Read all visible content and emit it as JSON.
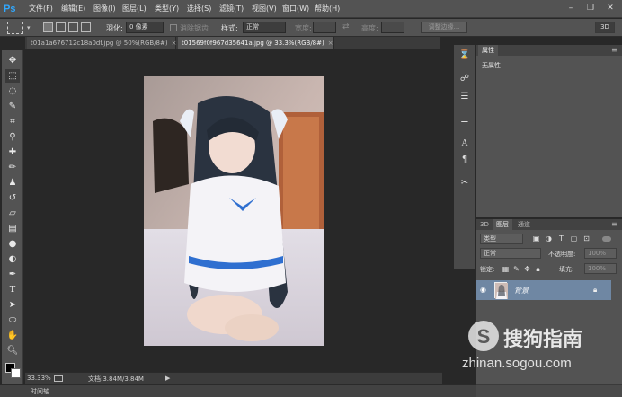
{
  "app": {
    "logo": "Ps"
  },
  "menu": [
    "文件(F)",
    "编辑(E)",
    "图像(I)",
    "图层(L)",
    "类型(Y)",
    "选择(S)",
    "滤镜(T)",
    "视图(V)",
    "窗口(W)",
    "帮助(H)"
  ],
  "options": {
    "feather_label": "羽化:",
    "feather_value": "0 像素",
    "antialias_label": "消除锯齿",
    "style_label": "样式:",
    "style_value": "正常",
    "width_label": "宽度:",
    "height_label": "高度:",
    "refine_edge": "调整边缘...",
    "workspace": "3D"
  },
  "tabs": [
    {
      "label": "t01a1a676712c18a0df.jpg @ 50%(RGB/8#)",
      "close": "×"
    },
    {
      "label": "t01569f0f967d35641a.jpg @ 33.3%(RGB/8#)",
      "close": "×"
    }
  ],
  "status": {
    "zoom": "33.33%",
    "doc": "文档:3.84M/3.84M"
  },
  "timeline": {
    "label": "时间轴"
  },
  "properties": {
    "tab": "属性",
    "empty_text": "无属性"
  },
  "layers": {
    "tabs": [
      "3D",
      "图层",
      "通道"
    ],
    "filter_kind": "类型",
    "blend_mode": "正常",
    "opacity_label": "不透明度:",
    "opacity_value": "100%",
    "lock_label": "锁定:",
    "fill_label": "填充:",
    "fill_value": "100%",
    "layer_name": "背景"
  },
  "watermark": {
    "brand": "搜狗指南",
    "url": "zhinan.sogou.com"
  },
  "colors": {
    "accent": "#31a8ff",
    "panel": "#535353",
    "canvas": "#282828",
    "selected_layer": "#6f87a3"
  }
}
